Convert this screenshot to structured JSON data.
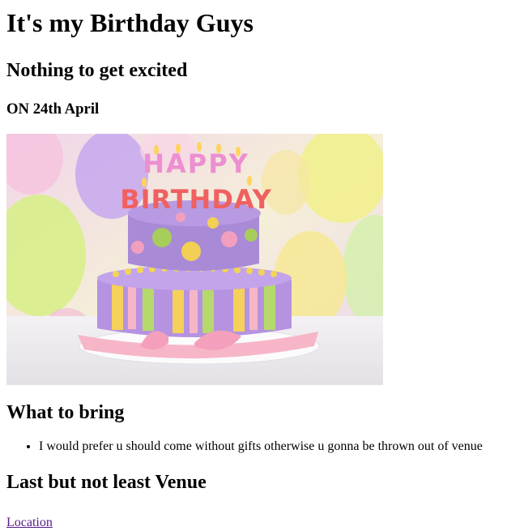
{
  "title": "It's my Birthday Guys",
  "subtitle": "Nothing to get excited",
  "date_line": "ON 24th April",
  "hero_image": {
    "icon": "birthday-cake-image",
    "candle_letters_top": "HAPPY",
    "candle_letters_bottom": "BIRTHDAY",
    "colors": {
      "cake_top": "#a98ad6",
      "cake_bottom": "#b593e0",
      "ribbon": "#f7b6c8",
      "stripe_yellow": "#f5d05a",
      "stripe_green": "#b6d96b"
    }
  },
  "what_to_bring": {
    "heading": "What to bring",
    "items": [
      "I would prefer u should come without gifts otherwise u gonna be thrown out of venue"
    ]
  },
  "venue": {
    "heading": "Last but not least Venue",
    "link_text": "Location",
    "link_color": "#551a8b"
  }
}
